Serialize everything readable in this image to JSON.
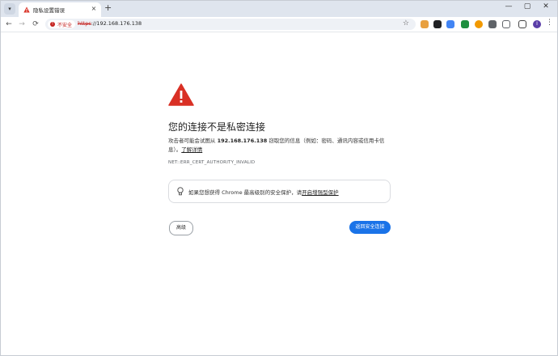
{
  "tab": {
    "title": "隐私设置错误",
    "close": "×",
    "new_tab": "+"
  },
  "window": {
    "minimize": "—",
    "maximize": "▢",
    "close": "✕"
  },
  "nav": {
    "back": "←",
    "forward": "→",
    "reload": "⟳"
  },
  "omnibox": {
    "security_chip": "不安全",
    "url_scheme": "https",
    "url_rest": "://192.168.176.138",
    "bookmark_icon": "star-icon"
  },
  "extensions": [
    {
      "name": "extension-1-icon",
      "color": "#e8a040"
    },
    {
      "name": "extension-2-icon",
      "color": "#202124"
    },
    {
      "name": "translate-icon",
      "color": "#4285f4"
    },
    {
      "name": "extension-4-icon",
      "color": "#1e8e3e"
    },
    {
      "name": "extension-5-icon",
      "color": "#f29900"
    },
    {
      "name": "extension-6-icon",
      "color": "#5f6368"
    },
    {
      "name": "extensions-puzzle-icon",
      "color": "#5f6368"
    },
    {
      "name": "sidepanel-icon",
      "color": "#444"
    }
  ],
  "profile": {
    "initial": "I"
  },
  "menu": "⋮",
  "page": {
    "heading": "您的连接不是私密连接",
    "body_pre": "攻击者可能会试图从 ",
    "body_host": "192.168.176.138",
    "body_post": " 窃取您的信息（例如：密码、通讯内容或信用卡信息）。",
    "learn_more": "了解详情",
    "error_code": "NET::ERR_CERT_AUTHORITY_INVALID",
    "tip_text": "如果您想获得 Chrome 最高级别的安全保护，请",
    "tip_link": "开启增强型保护",
    "advanced_button": "高级",
    "back_button": "返回安全连接"
  },
  "colors": {
    "danger": "#c5221f",
    "primary": "#1a73e8",
    "warning_icon": "#d93025"
  }
}
